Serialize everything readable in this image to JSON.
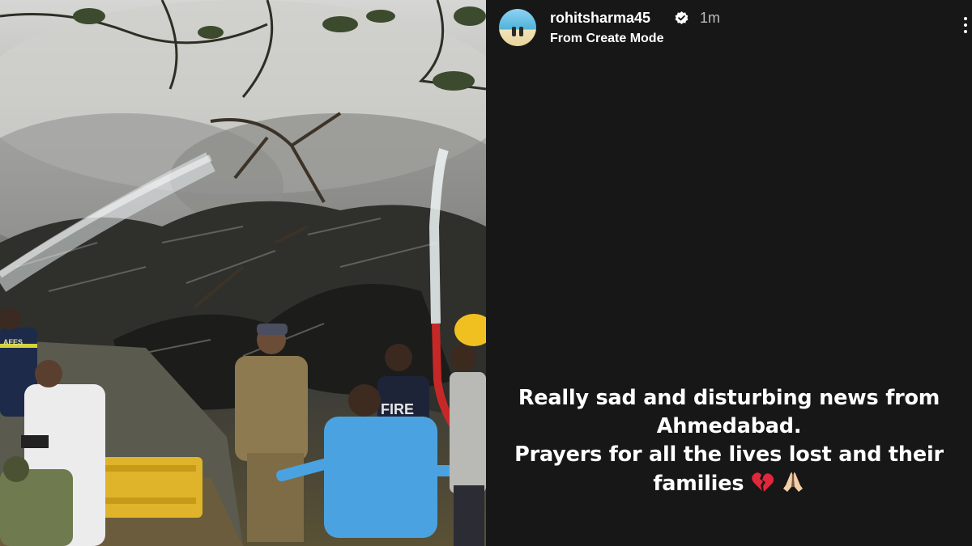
{
  "post": {
    "username": "rohitsharma45",
    "time": "1m",
    "subtitle": "From Create Mode",
    "verified": true
  },
  "story": {
    "lines": [
      "Really sad and disturbing news from",
      "Ahmedabad.",
      "Prayers for all the lives lost and their",
      "families"
    ],
    "emojis": [
      "broken-heart-icon",
      "folded-hands-icon"
    ],
    "background_color": "#171717"
  },
  "photo": {
    "vest_text": "FIRE",
    "jacket_text": "AFES"
  },
  "icons": [
    "verified-badge-icon",
    "more-options-icon"
  ]
}
